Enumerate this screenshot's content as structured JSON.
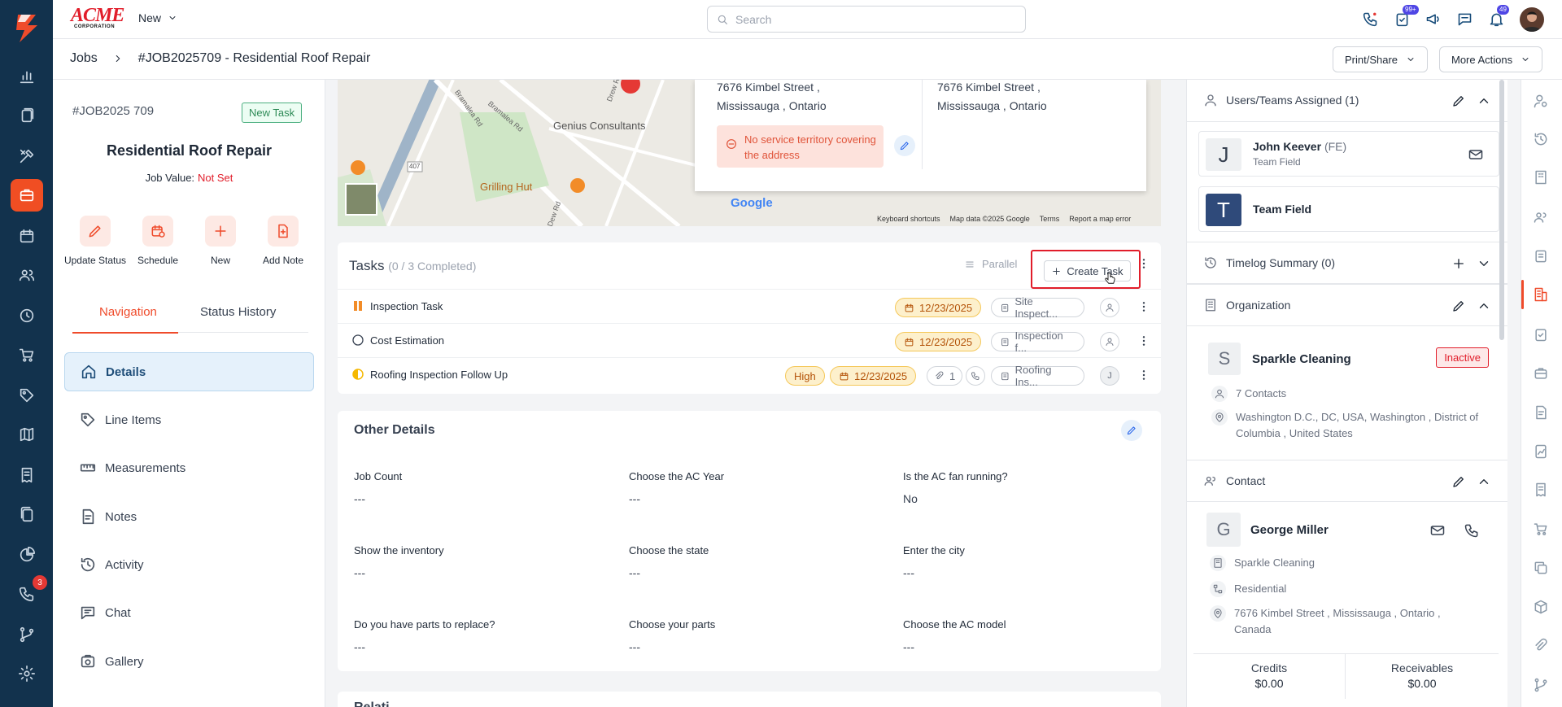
{
  "app": {
    "brand": "ACME",
    "brand_sub": "CORPORATION",
    "new_label": "New",
    "search_placeholder": "Search"
  },
  "topbar": {
    "notif_badge_1": "99+",
    "notif_badge_2": "49",
    "rail_badge": "3"
  },
  "colors": {
    "accent": "#ef4b2b",
    "rail": "#12324d",
    "link": "#1f4e79"
  },
  "breadcrumb": {
    "root": "Jobs",
    "current": "#JOB2025709 - Residential Roof Repair"
  },
  "header_actions": {
    "print": "Print/Share",
    "more": "More Actions"
  },
  "job": {
    "id": "#JOB2025 709",
    "badge": "New Task",
    "title": "Residential Roof Repair",
    "value_label": "Job Value:",
    "value": "Not Set"
  },
  "quick_actions": [
    "Update Status",
    "Schedule",
    "New",
    "Add Note"
  ],
  "left_tabs": {
    "navigation": "Navigation",
    "status_history": "Status History"
  },
  "nav": [
    "Details",
    "Line Items",
    "Measurements",
    "Notes",
    "Activity",
    "Chat",
    "Gallery"
  ],
  "map": {
    "address_line1": "7676 Kimbel Street ,",
    "address_line2": "Mississauga , Ontario",
    "address2_line1": "7676 Kimbel Street ,",
    "address2_line2": "Mississauga , Ontario",
    "warning": "No service territory covering the address",
    "places": [
      "Genius Consultants",
      "Grilling Hut"
    ],
    "roads": [
      "Bramalea Rd",
      "Bramalea Rd",
      "Drew Rd",
      "Dew Rd"
    ],
    "road_number": "407",
    "google": "Google",
    "footer": [
      "Keyboard shortcuts",
      "Map data ©2025 Google",
      "Terms",
      "Report a map error"
    ]
  },
  "tasks": {
    "title": "Tasks",
    "completed": "(0 / 3 Completed)",
    "parallel": "Parallel",
    "create": "Create Task",
    "rows": [
      {
        "name": "Inspection Task",
        "date": "12/23/2025",
        "tag": "Site Inspect..."
      },
      {
        "name": "Cost Estimation",
        "date": "12/23/2025",
        "tag": "Inspection f..."
      },
      {
        "name": "Roofing Inspection Follow Up",
        "priority": "High",
        "date": "12/23/2025",
        "attach": "1",
        "tag": "Roofing Ins...",
        "assignee": "J"
      }
    ]
  },
  "other_details": {
    "title": "Other Details",
    "fields": [
      {
        "label": "Job Count",
        "value": "---"
      },
      {
        "label": "Choose the AC Year",
        "value": "---"
      },
      {
        "label": "Is the AC fan running?",
        "value": "No"
      },
      {
        "label": "Show the inventory",
        "value": "---"
      },
      {
        "label": "Choose the state",
        "value": "---"
      },
      {
        "label": "Enter the city",
        "value": "---"
      },
      {
        "label": "Do you have parts to replace?",
        "value": "---"
      },
      {
        "label": "Choose your parts",
        "value": "---"
      },
      {
        "label": "Choose the AC model",
        "value": "---"
      }
    ],
    "next_title": "Relati..."
  },
  "right": {
    "users_title": "Users/Teams Assigned (1)",
    "user": {
      "initial": "J",
      "name": "John Keever",
      "suffix": "(FE)",
      "role": "Team Field"
    },
    "team": {
      "initial": "T",
      "name": "Team Field"
    },
    "timelog": "Timelog Summary (0)",
    "org_title": "Organization",
    "org": {
      "initial": "S",
      "name": "Sparkle Cleaning",
      "status": "Inactive",
      "contacts": "7 Contacts",
      "address": "Washington D.C., DC, USA, Washington , District of Columbia , United States"
    },
    "contact_title": "Contact",
    "contact": {
      "initial": "G",
      "name": "George Miller",
      "company": "Sparkle Cleaning",
      "type": "Residential",
      "address": "7676 Kimbel Street , Mississauga , Ontario , Canada"
    },
    "credits_label": "Credits",
    "credits": "$0.00",
    "receivables_label": "Receivables",
    "receivables": "$0.00"
  }
}
